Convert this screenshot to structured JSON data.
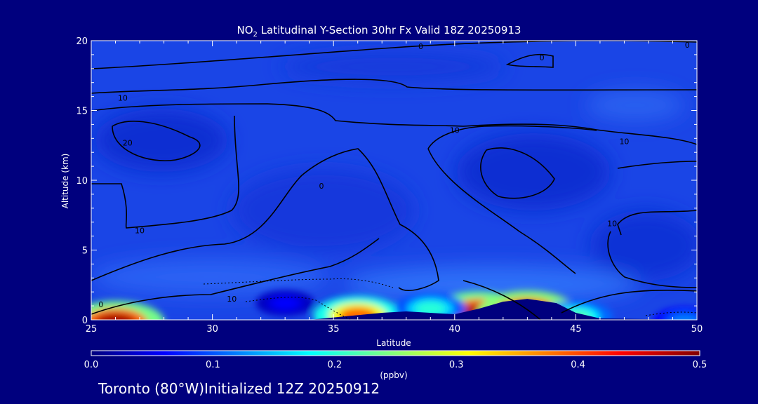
{
  "chart_data": {
    "type": "heatmap",
    "title_prefix": "NO",
    "title_sub": "2",
    "title_rest": " Latitudinal Y-Section 30hr  Fx Valid 18Z 20250913",
    "xlabel": "Latitude",
    "ylabel": "Altitude (km)",
    "xlim": [
      25,
      50
    ],
    "ylim": [
      0,
      20
    ],
    "xticks": [
      25,
      30,
      35,
      40,
      45,
      50
    ],
    "yticks": [
      0,
      5,
      10,
      15,
      20
    ],
    "colorbar": {
      "unit": "(ppbv)",
      "range": [
        0.0,
        0.5
      ],
      "tick_labels": [
        "0.0",
        "0.1",
        "0.2",
        "0.3",
        "0.4",
        "0.5"
      ]
    },
    "plumes": [
      {
        "lat": 26.0,
        "alt": 0.1,
        "value": 0.48
      },
      {
        "lat": 36.0,
        "alt": 0.6,
        "value": 0.38
      },
      {
        "lat": 41.0,
        "alt": 0.8,
        "value": 0.47
      },
      {
        "lat": 43.0,
        "alt": 0.8,
        "value": 0.5
      },
      {
        "lat": 39.0,
        "alt": 1.1,
        "value": 0.2
      },
      {
        "lat": 45.0,
        "alt": 0.5,
        "value": 0.22
      },
      {
        "lat": 33.0,
        "alt": 1.5,
        "value": 0.06
      },
      {
        "lat": 49.5,
        "alt": 0.2,
        "value": 0.12
      }
    ],
    "terrain": [
      [
        25,
        0
      ],
      [
        34,
        0
      ],
      [
        37,
        0.5
      ],
      [
        38,
        0.6
      ],
      [
        40,
        0.4
      ],
      [
        41,
        0.8
      ],
      [
        42,
        1.3
      ],
      [
        43,
        1.5
      ],
      [
        44.2,
        1.2
      ],
      [
        45,
        0.5
      ],
      [
        46,
        0.1
      ],
      [
        50,
        0
      ]
    ],
    "contour_labels": [
      {
        "text": "0",
        "lat": 38.6,
        "alt": 19.6
      },
      {
        "text": "0",
        "lat": 43.6,
        "alt": 18.8
      },
      {
        "text": "0",
        "lat": 49.6,
        "alt": 19.7
      },
      {
        "text": "10",
        "lat": 26.3,
        "alt": 15.9
      },
      {
        "text": "20",
        "lat": 26.5,
        "alt": 12.7
      },
      {
        "text": "10",
        "lat": 40.0,
        "alt": 13.6
      },
      {
        "text": "10",
        "lat": 47.0,
        "alt": 12.8
      },
      {
        "text": "0",
        "lat": 34.5,
        "alt": 9.6
      },
      {
        "text": "10",
        "lat": 27.0,
        "alt": 6.4
      },
      {
        "text": "10",
        "lat": 46.5,
        "alt": 6.9
      },
      {
        "text": "10",
        "lat": 30.8,
        "alt": 1.5
      },
      {
        "text": "0",
        "lat": 25.4,
        "alt": 1.1
      }
    ]
  },
  "footer": {
    "station": "Toronto (80°W)",
    "initialized": "Initialized 12Z 20250912"
  }
}
